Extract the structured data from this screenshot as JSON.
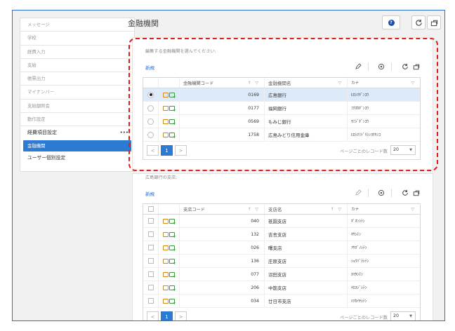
{
  "sidebar": {
    "items": [
      "メッセージ",
      "学校",
      "経費入力",
      "支給",
      "帳票出力",
      "マイナンバー",
      "支給額照会",
      "動作設定"
    ],
    "group_label": "経費項目設定",
    "group_menu_glyph": "•••",
    "active_item": "金融機関",
    "extra_item": "ユーザー個別設定"
  },
  "header": {
    "title": "金融機関",
    "help_glyph": "?"
  },
  "bank_panel": {
    "caption": "編集する金融機関を選んでください:",
    "new_label": "新規",
    "columns": {
      "code": "金融機関コード",
      "name": "金融機関名",
      "kana": "カナ"
    },
    "rows": [
      {
        "code": "0169",
        "name": "広島銀行",
        "kana": "ﾋﾛｼﾏｷﾞﾝｺｳ",
        "selected": true
      },
      {
        "code": "0177",
        "name": "福岡銀行",
        "kana": "ﾌｸｵｶｷﾞﾝｺｳ",
        "selected": false
      },
      {
        "code": "0569",
        "name": "もみじ銀行",
        "kana": "ﾓﾐｼﾞｷﾞﾝｺｳ",
        "selected": false
      },
      {
        "code": "1758",
        "name": "広島みどり信用金庫",
        "kana": "ﾋﾛｼﾏﾐﾄﾞﾘｼﾝﾖｳｷﾝｺ",
        "selected": false
      }
    ],
    "pager": {
      "prev": "<",
      "page": "1",
      "next": ">",
      "page_size_label": "ページごとのレコード数",
      "page_size": "20"
    }
  },
  "branch_panel": {
    "caption": "広島銀行の支店:",
    "new_label": "新規",
    "columns": {
      "code": "支店コード",
      "name": "支店名",
      "kana": "カナ"
    },
    "rows": [
      {
        "code": "040",
        "name": "祇園支店",
        "kana": "ｷﾞｵﾝｼﾃﾝ"
      },
      {
        "code": "132",
        "name": "吉舎支店",
        "kana": "ｷｻｼﾃﾝ"
      },
      {
        "code": "026",
        "name": "曙支店",
        "kana": "ｱｹﾎﾞﾉｼﾃﾝ"
      },
      {
        "code": "136",
        "name": "庄原支店",
        "kana": "ｼｮｳﾊﾞﾗｼﾃﾝ"
      },
      {
        "code": "077",
        "name": "沼田支店",
        "kana": "ﾇﾏﾀｼﾃﾝ"
      },
      {
        "code": "206",
        "name": "中筋支店",
        "kana": "ﾅｶｽｼﾞｼﾃﾝ"
      },
      {
        "code": "034",
        "name": "廿日市支店",
        "kana": "ﾊﾂｶｲﾁｼﾃﾝ"
      }
    ],
    "pager": {
      "prev": "<",
      "page": "1",
      "next": ">",
      "page_size_label": "ページごとのレコード数",
      "page_size": "20"
    }
  },
  "colors": {
    "accent": "#2d7ad3",
    "selected_row": "#dceafa",
    "highlight_border": "#e21b1b",
    "frame_border": "#2f6fd0"
  }
}
